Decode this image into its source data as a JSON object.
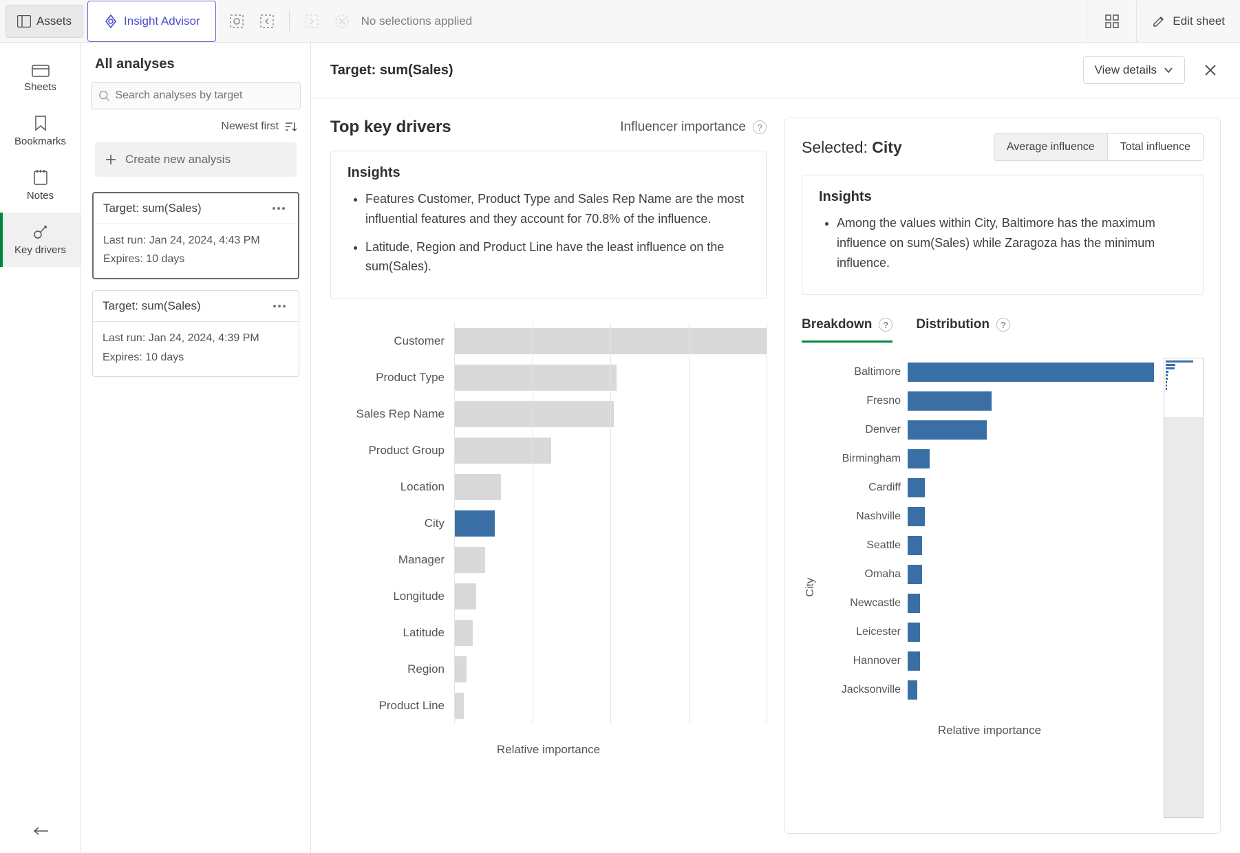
{
  "toolbar": {
    "assets_label": "Assets",
    "insight_label": "Insight Advisor",
    "no_selections": "No selections applied",
    "edit_sheet": "Edit sheet"
  },
  "rail": {
    "sheets": "Sheets",
    "bookmarks": "Bookmarks",
    "notes": "Notes",
    "key_drivers": "Key drivers"
  },
  "analyses": {
    "title": "All analyses",
    "search_placeholder": "Search analyses by target",
    "sort_label": "Newest first",
    "create_label": "Create new analysis",
    "cards": [
      {
        "title": "Target: sum(Sales)",
        "last_run": "Last run: Jan 24, 2024, 4:43 PM",
        "expires": "Expires: 10 days",
        "selected": true
      },
      {
        "title": "Target: sum(Sales)",
        "last_run": "Last run: Jan 24, 2024, 4:39 PM",
        "expires": "Expires: 10 days",
        "selected": false
      }
    ]
  },
  "header": {
    "title": "Target: sum(Sales)",
    "view_details": "View details"
  },
  "left_pane": {
    "title": "Top key drivers",
    "influencer": "Influencer importance",
    "insights_title": "Insights",
    "insights": [
      "Features Customer, Product Type and Sales Rep Name are the most influential features and they account for 70.8% of the influence.",
      "Latitude, Region and Product Line have the least influence on the sum(Sales)."
    ],
    "axis_label": "Relative importance"
  },
  "right_panel": {
    "selected_prefix": "Selected: ",
    "selected_value": "City",
    "toggle_avg": "Average influence",
    "toggle_total": "Total influence",
    "insights_title": "Insights",
    "insights": [
      "Among the values within City, Baltimore has the maximum influence on sum(Sales) while Zaragoza has the minimum influence."
    ],
    "tab_breakdown": "Breakdown",
    "tab_distribution": "Distribution",
    "ylabel": "City",
    "axis_label": "Relative importance"
  },
  "chart_data": [
    {
      "name": "key_drivers",
      "type": "bar",
      "orientation": "horizontal",
      "categories": [
        "Customer",
        "Product Type",
        "Sales Rep Name",
        "Product Group",
        "Location",
        "City",
        "Manager",
        "Longitude",
        "Latitude",
        "Region",
        "Product Line"
      ],
      "values": [
        100,
        52,
        51,
        31,
        15,
        13,
        10,
        7,
        6,
        4,
        3
      ],
      "highlighted": "City",
      "xlabel": "Relative importance",
      "xlim": [
        0,
        100
      ],
      "gridlines": [
        0,
        25,
        50,
        75,
        100
      ]
    },
    {
      "name": "city_breakdown",
      "type": "bar",
      "orientation": "horizontal",
      "categories": [
        "Baltimore",
        "Fresno",
        "Denver",
        "Birmingham",
        "Cardiff",
        "Nashville",
        "Seattle",
        "Omaha",
        "Newcastle",
        "Leicester",
        "Hannover",
        "Jacksonville"
      ],
      "values": [
        100,
        34,
        32,
        9,
        7,
        7,
        6,
        6,
        5,
        5,
        5,
        4
      ],
      "xlabel": "Relative importance",
      "ylabel": "City",
      "xlim": [
        0,
        100
      ]
    }
  ]
}
